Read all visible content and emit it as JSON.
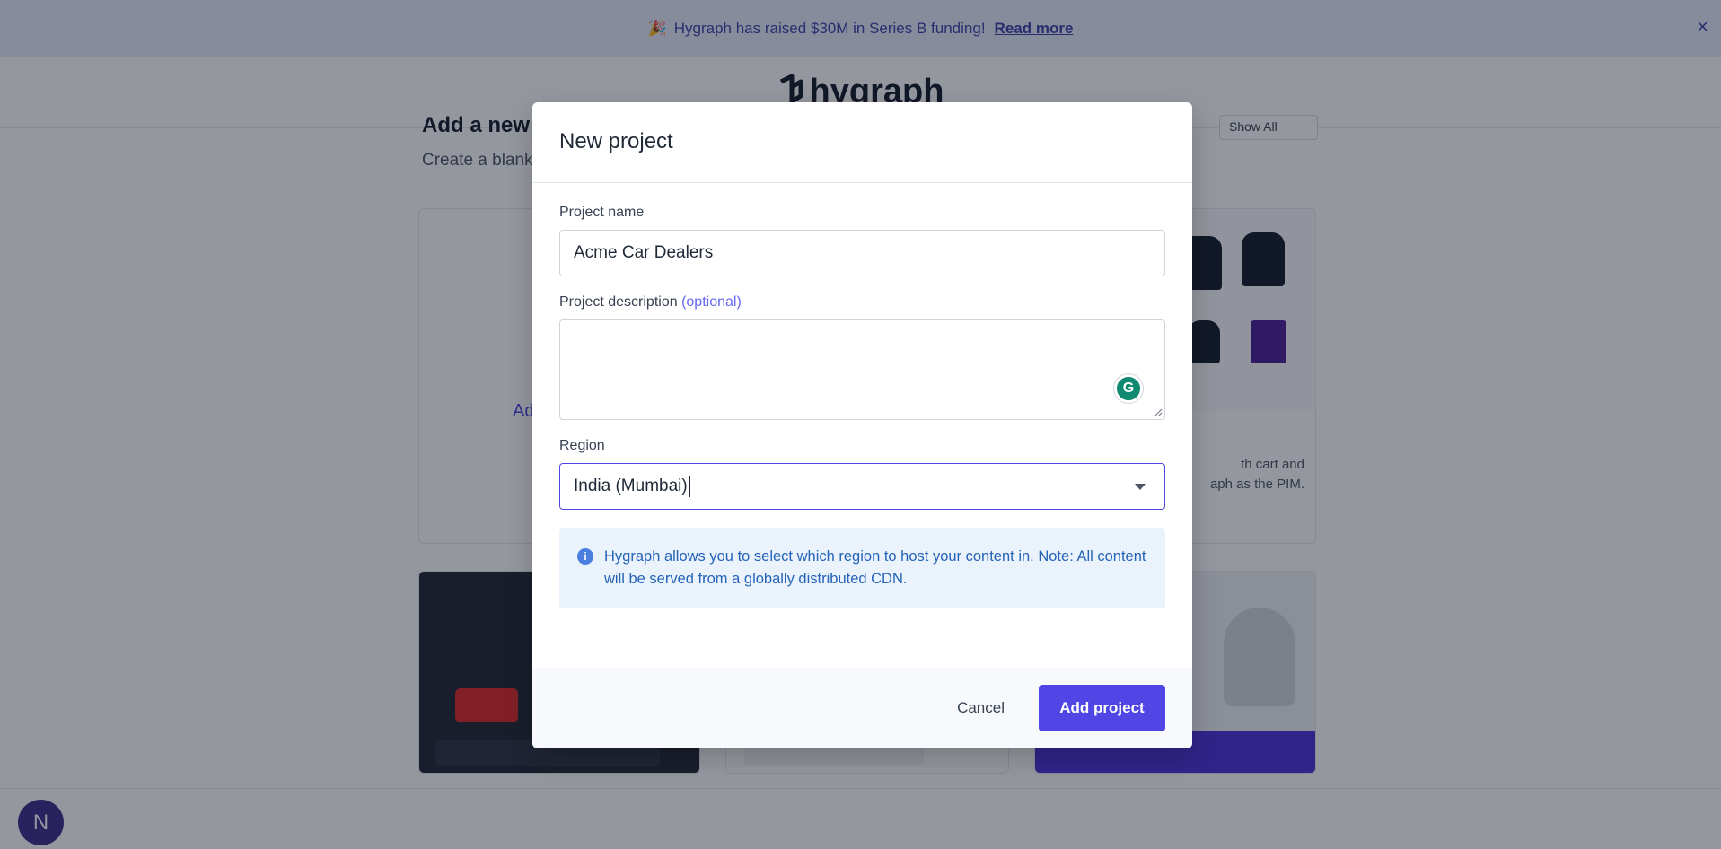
{
  "banner": {
    "emoji": "🎉",
    "message": "Hygraph has raised $30M in Series B funding!",
    "link_label": "Read more",
    "close_icon": "×"
  },
  "header": {
    "brand_name": "hygraph"
  },
  "background": {
    "heading": "Add a new p",
    "subheading": "Create a blank",
    "show_all_label": "Show All",
    "blank_card_label": "Ad",
    "shop_card_desc_line1": "th cart and",
    "shop_card_desc_line2": "aph as the PIM."
  },
  "user": {
    "avatar_initial": "N"
  },
  "modal": {
    "title": "New project",
    "fields": {
      "name_label": "Project name",
      "name_value": "Acme Car Dealers",
      "description_label": "Project description",
      "description_optional": "(optional)",
      "description_value": "",
      "region_label": "Region",
      "region_value": "India (Mumbai)"
    },
    "info": {
      "icon": "i",
      "text": "Hygraph allows you to select which region to host your content in. Note: All content will be served from a globally distributed CDN."
    },
    "footer": {
      "cancel_label": "Cancel",
      "submit_label": "Add project"
    }
  },
  "colors": {
    "accent": "#4f46e5",
    "info_bg": "#eaf3fc",
    "info_text": "#2563b8",
    "banner_bg": "#e8ebfb"
  }
}
